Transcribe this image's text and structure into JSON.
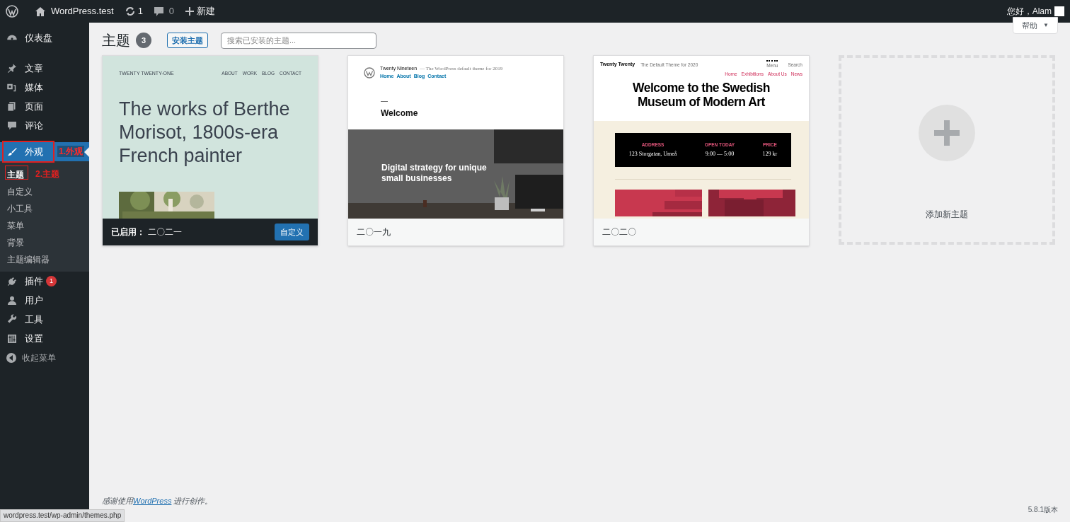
{
  "admin_bar": {
    "site": "WordPress.test",
    "updates": "1",
    "comments": "0",
    "new": "新建",
    "greeting": "您好，Alam"
  },
  "sidebar": {
    "items": [
      {
        "label": "仪表盘",
        "selected": false
      },
      {
        "label": "文章",
        "selected": false
      },
      {
        "label": "媒体",
        "selected": false
      },
      {
        "label": "页面",
        "selected": false
      },
      {
        "label": "评论",
        "selected": false
      },
      {
        "label": "外观",
        "selected": true,
        "annotation": "1.外观",
        "children": [
          {
            "label": "主题",
            "selected": true,
            "annotation": "2.主题"
          },
          {
            "label": "自定义",
            "selected": false
          },
          {
            "label": "小工具",
            "selected": false
          },
          {
            "label": "菜单",
            "selected": false
          },
          {
            "label": "背景",
            "selected": false
          },
          {
            "label": "主题编辑器",
            "selected": false
          }
        ]
      },
      {
        "label": "插件",
        "selected": false,
        "badge": "1"
      },
      {
        "label": "用户",
        "selected": false
      },
      {
        "label": "工具",
        "selected": false
      },
      {
        "label": "设置",
        "selected": false
      }
    ],
    "collapse": "收起菜单"
  },
  "help": {
    "label": "帮助",
    "caret": "▼"
  },
  "header": {
    "title": "主题",
    "count": "3",
    "add_button": "安装主题",
    "search": {
      "placeholder": "搜索已安装的主题..."
    }
  },
  "themes": [
    {
      "name": "二〇二一",
      "active": true,
      "active_label": "已启用：",
      "customize": "自定义",
      "preview": {
        "kind": "twentyone",
        "site": "TWENTY TWENTY-ONE",
        "nav": [
          "ABOUT",
          "WORK",
          "BLOG",
          "CONTACT"
        ],
        "heading": "The works of Berthe Morisot, 1800s-era French painter"
      }
    },
    {
      "name": "二〇一九",
      "active": false,
      "preview": {
        "kind": "nineteen",
        "site": "Twenty Nineteen",
        "tagline": "— The WordPress default theme for 2019",
        "nav": [
          "Home",
          "About",
          "Blog",
          "Contact"
        ],
        "heading": "Welcome",
        "hero": "Digital strategy for unique small businesses"
      }
    },
    {
      "name": "二〇二〇",
      "active": false,
      "preview": {
        "kind": "twenty",
        "site": "Twenty Twenty",
        "tagline": "The Default Theme for 2020",
        "nav": [
          "Home",
          "Exhibitions",
          "About Us",
          "News"
        ],
        "menu": "Menu",
        "search": "Search",
        "heading": "Welcome to the Swedish Museum of Modern Art",
        "facts": [
          {
            "label": "ADDRESS",
            "value": "123 Storgatan, Umeå"
          },
          {
            "label": "OPEN TODAY",
            "value": "9:00 — 5:00"
          },
          {
            "label": "PRICE",
            "value": "129 kr"
          }
        ]
      }
    }
  ],
  "add_new": "添加新主题",
  "footer": {
    "before": "感谢使用",
    "link": "WordPress",
    "after": " 进行创作。",
    "version": "5.8.1版本"
  },
  "status_url": "wordpress.test/wp-admin/themes.php"
}
